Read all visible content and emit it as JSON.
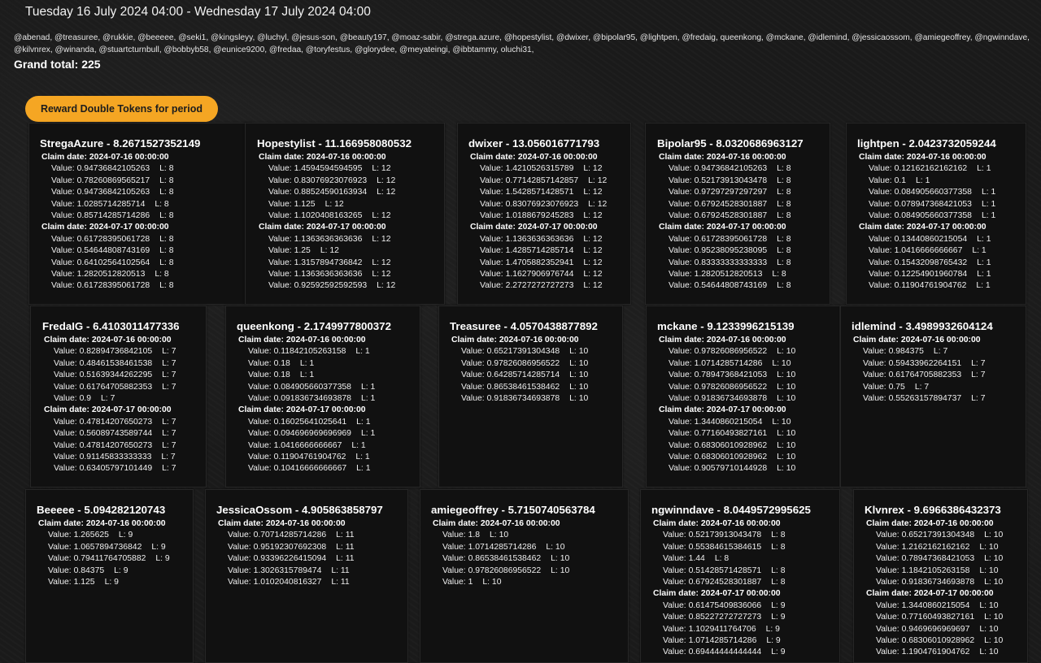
{
  "header": {
    "date_range": "Tuesday 16 July 2024 04:00 - Wednesday 17 July 2024 04:00",
    "users_line": "@abenad, @treasuree, @rukkie, @beeeee, @seki1, @kingsleyy, @luchyl, @jesus-son, @beauty197, @moaz-sabir, @strega.azure, @hopestylist, @dwixer, @bipolar95, @lightpen, @fredaig, queenkong, @mckane, @idlemind, @jessicaossom, @amiegeoffrey, @ngwinndave, @kilvnrex, @winanda, @stuartcturnbull, @bobbyb58, @eunice9200, @fredaa, @toryfestus, @glorydee, @meyateingi, @ibbtammy, oluchi31,",
    "grand_total_label": "Grand total:",
    "grand_total_value": "225"
  },
  "reward_button": {
    "label": "Reward Double Tokens for period"
  },
  "labels": {
    "claim_date": "Claim date:",
    "value": "Value:",
    "level": "L:"
  },
  "cards": [
    {
      "title": "StregaAzure - 8.2671527352149",
      "groups": [
        {
          "date": "2024-07-16 00:00:00",
          "rows": [
            [
              "0.94736842105263",
              "8"
            ],
            [
              "0.78260869565217",
              "8"
            ],
            [
              "0.94736842105263",
              "8"
            ],
            [
              "1.0285714285714",
              "8"
            ],
            [
              "0.85714285714286",
              "8"
            ]
          ]
        },
        {
          "date": "2024-07-17 00:00:00",
          "rows": [
            [
              "0.61728395061728",
              "8"
            ],
            [
              "0.54644808743169",
              "8"
            ],
            [
              "0.64102564102564",
              "8"
            ],
            [
              "1.2820512820513",
              "8"
            ],
            [
              "0.61728395061728",
              "8"
            ]
          ]
        }
      ]
    },
    {
      "title": "Hopestylist - 11.166958080532",
      "groups": [
        {
          "date": "2024-07-16 00:00:00",
          "rows": [
            [
              "1.4594594594595",
              "12"
            ],
            [
              "0.83076923076923",
              "12"
            ],
            [
              "0.88524590163934",
              "12"
            ],
            [
              "1.125",
              "12"
            ],
            [
              "1.1020408163265",
              "12"
            ]
          ]
        },
        {
          "date": "2024-07-17 00:00:00",
          "rows": [
            [
              "1.1363636363636",
              "12"
            ],
            [
              "1.25",
              "12"
            ],
            [
              "1.3157894736842",
              "12"
            ],
            [
              "1.1363636363636",
              "12"
            ],
            [
              "0.92592592592593",
              "12"
            ]
          ]
        }
      ]
    },
    {
      "title": "dwixer - 13.056016771793",
      "groups": [
        {
          "date": "2024-07-16 00:00:00",
          "rows": [
            [
              "1.4210526315789",
              "12"
            ],
            [
              "0.77142857142857",
              "12"
            ],
            [
              "1.5428571428571",
              "12"
            ],
            [
              "0.83076923076923",
              "12"
            ],
            [
              "1.0188679245283",
              "12"
            ]
          ]
        },
        {
          "date": "2024-07-17 00:00:00",
          "rows": [
            [
              "1.1363636363636",
              "12"
            ],
            [
              "1.4285714285714",
              "12"
            ],
            [
              "1.4705882352941",
              "12"
            ],
            [
              "1.1627906976744",
              "12"
            ],
            [
              "2.2727272727273",
              "12"
            ]
          ]
        }
      ]
    },
    {
      "title": "Bipolar95 - 8.0320686963127",
      "groups": [
        {
          "date": "2024-07-16 00:00:00",
          "rows": [
            [
              "0.94736842105263",
              "8"
            ],
            [
              "0.52173913043478",
              "8"
            ],
            [
              "0.97297297297297",
              "8"
            ],
            [
              "0.67924528301887",
              "8"
            ],
            [
              "0.67924528301887",
              "8"
            ]
          ]
        },
        {
          "date": "2024-07-17 00:00:00",
          "rows": [
            [
              "0.61728395061728",
              "8"
            ],
            [
              "0.95238095238095",
              "8"
            ],
            [
              "0.83333333333333",
              "8"
            ],
            [
              "1.2820512820513",
              "8"
            ],
            [
              "0.54644808743169",
              "8"
            ]
          ]
        }
      ]
    },
    {
      "title": "lightpen - 2.0423732059244",
      "groups": [
        {
          "date": "2024-07-16 00:00:00",
          "rows": [
            [
              "0.12162162162162",
              "1"
            ],
            [
              "0.1",
              "1"
            ],
            [
              "0.084905660377358",
              "1"
            ],
            [
              "0.078947368421053",
              "1"
            ],
            [
              "0.084905660377358",
              "1"
            ]
          ]
        },
        {
          "date": "2024-07-17 00:00:00",
          "rows": [
            [
              "0.13440860215054",
              "1"
            ],
            [
              "1.0416666666667",
              "1"
            ],
            [
              "0.15432098765432",
              "1"
            ],
            [
              "0.12254901960784",
              "1"
            ],
            [
              "0.11904761904762",
              "1"
            ]
          ]
        }
      ]
    },
    {
      "title": "FredaIG - 6.4103011477336",
      "groups": [
        {
          "date": "2024-07-16 00:00:00",
          "rows": [
            [
              "0.82894736842105",
              "7"
            ],
            [
              "0.48461538461538",
              "7"
            ],
            [
              "0.51639344262295",
              "7"
            ],
            [
              "0.61764705882353",
              "7"
            ],
            [
              "0.9",
              "7"
            ]
          ]
        },
        {
          "date": "2024-07-17 00:00:00",
          "rows": [
            [
              "0.47814207650273",
              "7"
            ],
            [
              "0.56089743589744",
              "7"
            ],
            [
              "0.47814207650273",
              "7"
            ],
            [
              "0.91145833333333",
              "7"
            ],
            [
              "0.63405797101449",
              "7"
            ]
          ]
        }
      ]
    },
    {
      "title": "queenkong - 2.1749977800372",
      "groups": [
        {
          "date": "2024-07-16 00:00:00",
          "rows": [
            [
              "0.11842105263158",
              "1"
            ],
            [
              "0.18",
              "1"
            ],
            [
              "0.18",
              "1"
            ],
            [
              "0.084905660377358",
              "1"
            ],
            [
              "0.091836734693878",
              "1"
            ]
          ]
        },
        {
          "date": "2024-07-17 00:00:00",
          "rows": [
            [
              "0.16025641025641",
              "1"
            ],
            [
              "0.094696969696969",
              "1"
            ],
            [
              "1.0416666666667",
              "1"
            ],
            [
              "0.11904761904762",
              "1"
            ],
            [
              "0.10416666666667",
              "1"
            ]
          ]
        }
      ]
    },
    {
      "title": "Treasuree - 4.0570438877892",
      "groups": [
        {
          "date": "2024-07-16 00:00:00",
          "rows": [
            [
              "0.65217391304348",
              "10"
            ],
            [
              "0.97826086956522",
              "10"
            ],
            [
              "0.64285714285714",
              "10"
            ],
            [
              "0.86538461538462",
              "10"
            ],
            [
              "0.91836734693878",
              "10"
            ]
          ]
        }
      ]
    },
    {
      "title": "mckane - 9.1233996215139",
      "groups": [
        {
          "date": "2024-07-16 00:00:00",
          "rows": [
            [
              "0.97826086956522",
              "10"
            ],
            [
              "1.0714285714286",
              "10"
            ],
            [
              "0.78947368421053",
              "10"
            ],
            [
              "0.97826086956522",
              "10"
            ],
            [
              "0.91836734693878",
              "10"
            ]
          ]
        },
        {
          "date": "2024-07-17 00:00:00",
          "rows": [
            [
              "1.3440860215054",
              "10"
            ],
            [
              "0.77160493827161",
              "10"
            ],
            [
              "0.68306010928962",
              "10"
            ],
            [
              "0.68306010928962",
              "10"
            ],
            [
              "0.90579710144928",
              "10"
            ]
          ]
        }
      ]
    },
    {
      "title": "idlemind - 3.4989932604124",
      "groups": [
        {
          "date": "2024-07-16 00:00:00",
          "rows": [
            [
              "0.984375",
              "7"
            ],
            [
              "0.59433962264151",
              "7"
            ],
            [
              "0.61764705882353",
              "7"
            ],
            [
              "0.75",
              "7"
            ],
            [
              "0.55263157894737",
              "7"
            ]
          ]
        }
      ]
    },
    {
      "title": "Beeeee - 5.094282120743",
      "groups": [
        {
          "date": "2024-07-16 00:00:00",
          "rows": [
            [
              "1.265625",
              "9"
            ],
            [
              "1.0657894736842",
              "9"
            ],
            [
              "0.79411764705882",
              "9"
            ],
            [
              "0.84375",
              "9"
            ],
            [
              "1.125",
              "9"
            ]
          ]
        }
      ]
    },
    {
      "title": "JessicaOssom - 4.905863858797",
      "groups": [
        {
          "date": "2024-07-16 00:00:00",
          "rows": [
            [
              "0.70714285714286",
              "11"
            ],
            [
              "0.95192307692308",
              "11"
            ],
            [
              "0.93396226415094",
              "11"
            ],
            [
              "1.3026315789474",
              "11"
            ],
            [
              "1.0102040816327",
              "11"
            ]
          ]
        }
      ]
    },
    {
      "title": "amiegeoffrey - 5.7150740563784",
      "groups": [
        {
          "date": "2024-07-16 00:00:00",
          "rows": [
            [
              "1.8",
              "10"
            ],
            [
              "1.0714285714286",
              "10"
            ],
            [
              "0.86538461538462",
              "10"
            ],
            [
              "0.97826086956522",
              "10"
            ],
            [
              "1",
              "10"
            ]
          ]
        }
      ]
    },
    {
      "title": "ngwinndave - 8.0449572995625",
      "groups": [
        {
          "date": "2024-07-16 00:00:00",
          "rows": [
            [
              "0.52173913043478",
              "8"
            ],
            [
              "0.55384615384615",
              "8"
            ],
            [
              "1.44",
              "8"
            ],
            [
              "0.51428571428571",
              "8"
            ],
            [
              "0.67924528301887",
              "8"
            ]
          ]
        },
        {
          "date": "2024-07-17 00:00:00",
          "rows": [
            [
              "0.61475409836066",
              "9"
            ],
            [
              "0.85227272727273",
              "9"
            ],
            [
              "1.1029411764706",
              "9"
            ],
            [
              "1.0714285714286",
              "9"
            ],
            [
              "0.69444444444444",
              "9"
            ]
          ]
        }
      ]
    },
    {
      "title": "Klvnrex - 9.6966386432373",
      "groups": [
        {
          "date": "2024-07-16 00:00:00",
          "rows": [
            [
              "0.65217391304348",
              "10"
            ],
            [
              "1.2162162162162",
              "10"
            ],
            [
              "0.78947368421053",
              "10"
            ],
            [
              "1.1842105263158",
              "10"
            ],
            [
              "0.91836734693878",
              "10"
            ]
          ]
        },
        {
          "date": "2024-07-17 00:00:00",
          "rows": [
            [
              "1.3440860215054",
              "10"
            ],
            [
              "0.77160493827161",
              "10"
            ],
            [
              "0.9469696969697",
              "10"
            ],
            [
              "0.68306010928962",
              "10"
            ],
            [
              "1.1904761904762",
              "10"
            ]
          ]
        }
      ]
    }
  ]
}
